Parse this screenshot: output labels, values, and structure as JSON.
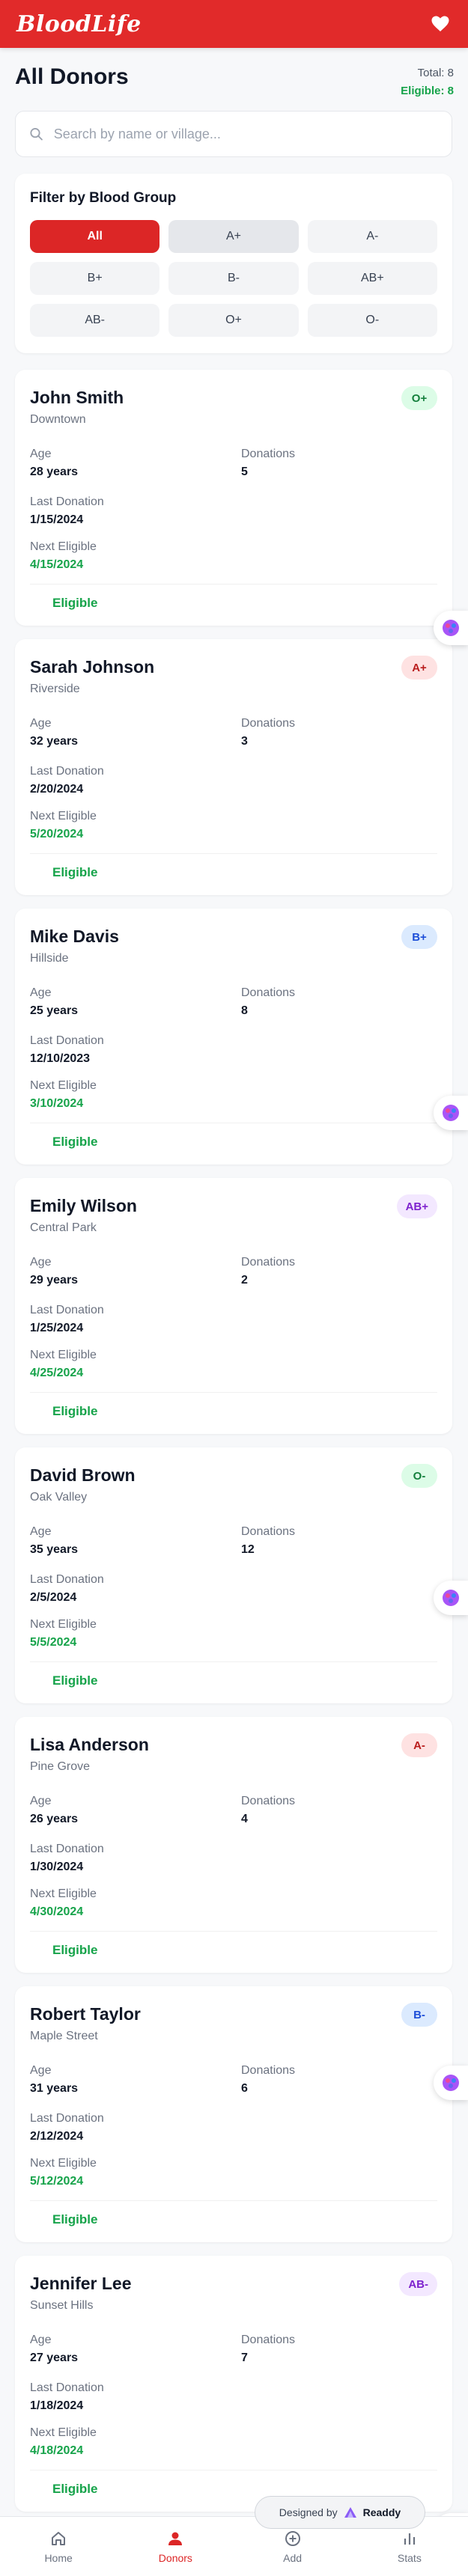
{
  "header": {
    "logo": "BloodLife",
    "heart_icon": "heart-icon"
  },
  "page": {
    "title": "All Donors",
    "total": "Total: 8",
    "eligible": "Eligible: 8"
  },
  "search": {
    "placeholder": "Search by name or village...",
    "value": ""
  },
  "filter": {
    "title": "Filter by Blood Group",
    "options": [
      "All",
      "A+",
      "A-",
      "B+",
      "B-",
      "AB+",
      "AB-",
      "O+",
      "O-"
    ],
    "selected": "All"
  },
  "labels": {
    "age": "Age",
    "donations": "Donations",
    "last_donation": "Last Donation",
    "next_eligible": "Next Eligible"
  },
  "donors": [
    {
      "name": "John Smith",
      "location": "Downtown",
      "blood": "O+",
      "age": "28 years",
      "donations": "5",
      "last": "1/15/2024",
      "next": "4/15/2024",
      "status": "Eligible"
    },
    {
      "name": "Sarah Johnson",
      "location": "Riverside",
      "blood": "A+",
      "age": "32 years",
      "donations": "3",
      "last": "2/20/2024",
      "next": "5/20/2024",
      "status": "Eligible"
    },
    {
      "name": "Mike Davis",
      "location": "Hillside",
      "blood": "B+",
      "age": "25 years",
      "donations": "8",
      "last": "12/10/2023",
      "next": "3/10/2024",
      "status": "Eligible"
    },
    {
      "name": "Emily Wilson",
      "location": "Central Park",
      "blood": "AB+",
      "age": "29 years",
      "donations": "2",
      "last": "1/25/2024",
      "next": "4/25/2024",
      "status": "Eligible"
    },
    {
      "name": "David Brown",
      "location": "Oak Valley",
      "blood": "O-",
      "age": "35 years",
      "donations": "12",
      "last": "2/5/2024",
      "next": "5/5/2024",
      "status": "Eligible"
    },
    {
      "name": "Lisa Anderson",
      "location": "Pine Grove",
      "blood": "A-",
      "age": "26 years",
      "donations": "4",
      "last": "1/30/2024",
      "next": "4/30/2024",
      "status": "Eligible"
    },
    {
      "name": "Robert Taylor",
      "location": "Maple Street",
      "blood": "B-",
      "age": "31 years",
      "donations": "6",
      "last": "2/12/2024",
      "next": "5/12/2024",
      "status": "Eligible"
    },
    {
      "name": "Jennifer Lee",
      "location": "Sunset Hills",
      "blood": "AB-",
      "age": "27 years",
      "donations": "7",
      "last": "1/18/2024",
      "next": "4/18/2024",
      "status": "Eligible"
    }
  ],
  "badge_colors": {
    "O": {
      "bg": "#dcfce7",
      "fg": "#15803d"
    },
    "A": {
      "bg": "#fee2e2",
      "fg": "#b91c1c"
    },
    "B": {
      "bg": "#dbeafe",
      "fg": "#1d4ed8"
    },
    "AB": {
      "bg": "#f3e8ff",
      "fg": "#7e22ce"
    }
  },
  "readdy": {
    "prefix": "Designed by",
    "brand": "Readdy"
  },
  "nav": [
    {
      "label": "Home",
      "icon": "home-icon",
      "active": false
    },
    {
      "label": "Donors",
      "icon": "user-icon",
      "active": true
    },
    {
      "label": "Add",
      "icon": "add-circle-icon",
      "active": false
    },
    {
      "label": "Stats",
      "icon": "bar-chart-icon",
      "active": false
    }
  ],
  "colors": {
    "brand": "#e12a2a",
    "eligible": "#16a34a"
  }
}
